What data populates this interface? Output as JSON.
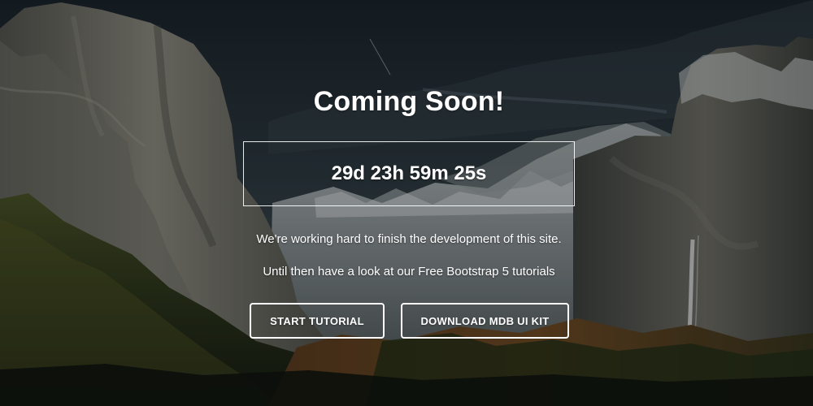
{
  "hero": {
    "title": "Coming Soon!",
    "countdown": "29d 23h 59m 25s",
    "message_1": "We're working hard to finish the development of this site.",
    "message_2": "Until then have a look at our Free Bootstrap 5 tutorials"
  },
  "buttons": {
    "start_tutorial": "START TUTORIAL",
    "download_kit": "DOWNLOAD MDB UI KIT"
  },
  "colors": {
    "text": "#ffffff",
    "overlay": "#000000",
    "sky": "#243038",
    "rock": "#6b6a63",
    "forest": "#3f4a22"
  }
}
